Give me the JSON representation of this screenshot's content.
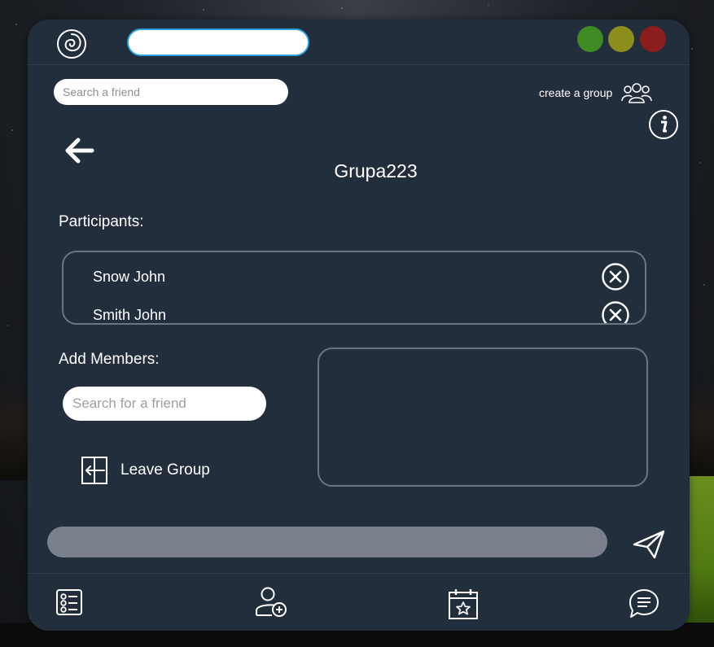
{
  "colors": {
    "window_bg": "#232e3d",
    "accent_blue": "#2aa1e0",
    "minimize_green": "#3f8a22",
    "maximize_olive": "#8c8f1b",
    "close_red": "#8c1d1d",
    "border_gray": "#6a7584",
    "message_bar": "#7a818c"
  },
  "titlebar": {
    "logo_icon": "spiral-logo-icon",
    "title_input_value": "",
    "window_buttons": [
      "minimize",
      "maximize",
      "close"
    ]
  },
  "header": {
    "friend_search_placeholder": "Search a friend",
    "create_group_label": "create a group",
    "create_group_icon": "group-icon",
    "info_icon": "info-icon"
  },
  "group": {
    "back_icon": "arrow-left-icon",
    "name": "Grupa223",
    "participants_label": "Participants:",
    "participants": [
      {
        "name": "Snow John"
      },
      {
        "name": "Smith John"
      }
    ],
    "add_members_label": "Add Members:",
    "member_search_placeholder": "Search for a friend",
    "leave_label": "Leave Group",
    "leave_icon": "exit-door-icon"
  },
  "composer": {
    "message_value": "",
    "send_icon": "paper-plane-icon"
  },
  "bottom_nav": [
    {
      "icon": "task-list-icon"
    },
    {
      "icon": "add-user-icon"
    },
    {
      "icon": "calendar-star-icon"
    },
    {
      "icon": "chat-bubble-icon"
    }
  ]
}
